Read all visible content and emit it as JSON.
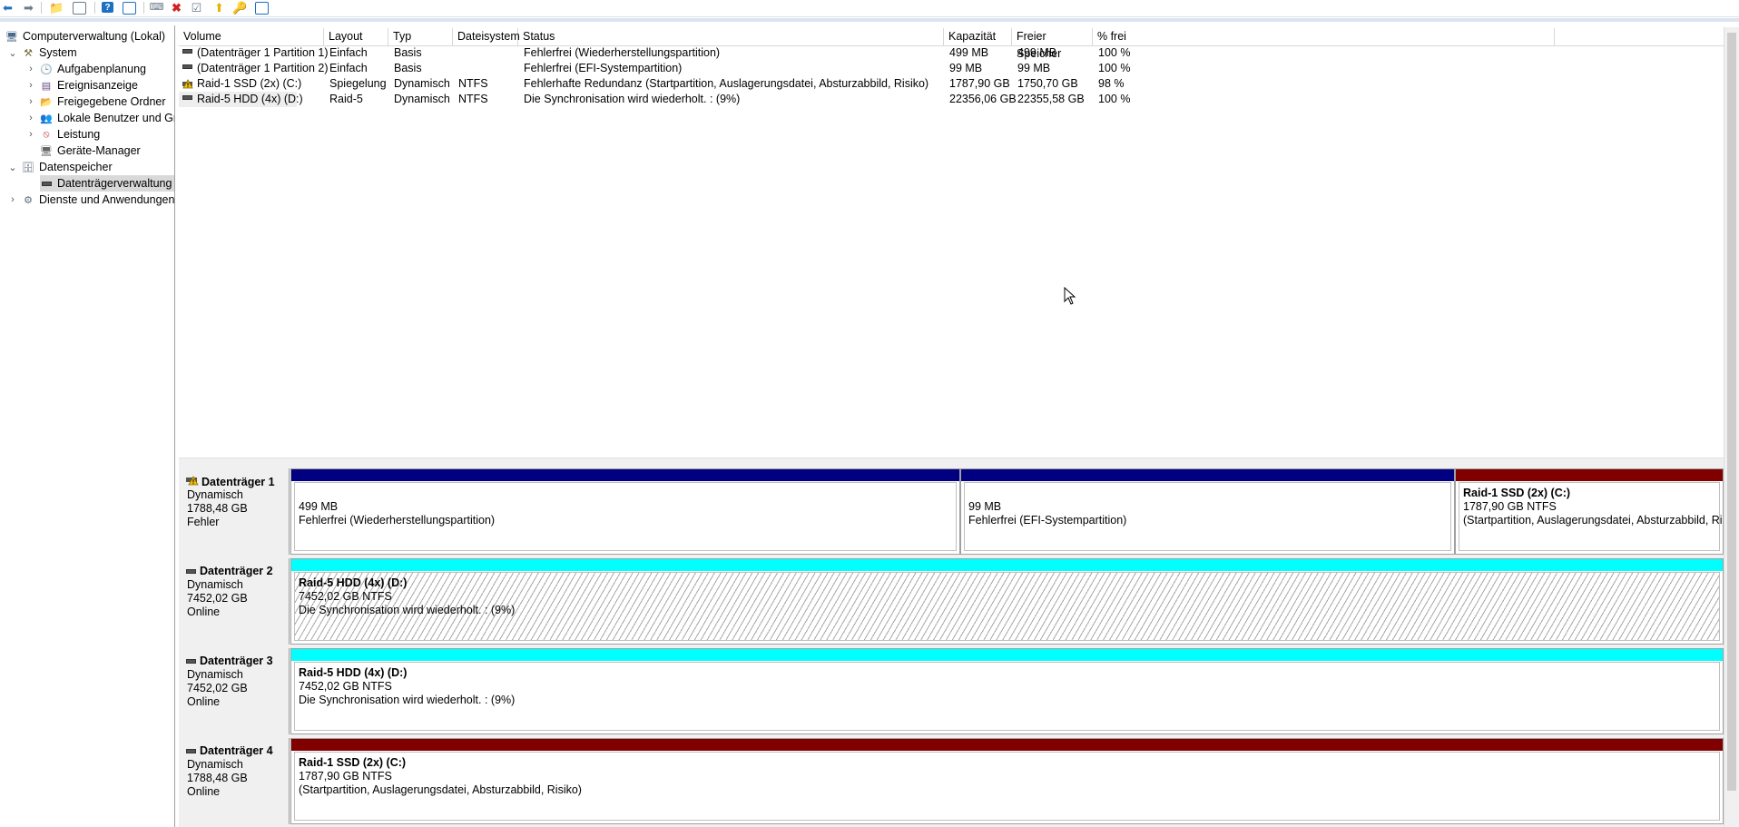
{
  "toolbar": {
    "buttons": [
      "back-icon",
      "forward-icon",
      "up-folder-icon",
      "console-tree-icon",
      "help-icon",
      "properties-icon",
      "connect-icon",
      "delete-icon",
      "checkmark-icon",
      "export-icon",
      "disk-action-icon",
      "list-view-icon"
    ],
    "colors": {
      "blue": "#1e6fc2",
      "red": "#d42020",
      "yellow": "#e3b400",
      "gray": "#6b7b8c"
    }
  },
  "tree": {
    "root": "Computerverwaltung (Lokal)",
    "system": "System",
    "aufgabenplanung": "Aufgabenplanung",
    "ereignisanzeige": "Ereignisanzeige",
    "freigegebene": "Freigegebene Ordner",
    "benutzer": "Lokale Benutzer und Gr",
    "leistung": "Leistung",
    "geraete": "Geräte-Manager",
    "datenspeicher": "Datenspeicher",
    "datentraeger": "Datenträgerverwaltung",
    "dienste": "Dienste und Anwendungen"
  },
  "volumes": {
    "headers": {
      "volume": "Volume",
      "layout": "Layout",
      "typ": "Typ",
      "dateisystem": "Dateisystem",
      "status": "Status",
      "kapazitaet": "Kapazität",
      "frei": "Freier Speicher",
      "prozent": "% frei"
    },
    "rows": [
      {
        "volume": "(Datenträger 1 Partition 1)",
        "layout": "Einfach",
        "typ": "Basis",
        "dateisystem": "",
        "status": "Fehlerfrei (Wiederherstellungspartition)",
        "kapazitaet": "499 MB",
        "frei": "499 MB",
        "prozent": "100 %"
      },
      {
        "volume": "(Datenträger 1 Partition 2)",
        "layout": "Einfach",
        "typ": "Basis",
        "dateisystem": "",
        "status": "Fehlerfrei (EFI-Systempartition)",
        "kapazitaet": "99 MB",
        "frei": "99 MB",
        "prozent": "100 %"
      },
      {
        "volume": "Raid-1 SSD (2x) (C:)",
        "layout": "Spiegelung",
        "typ": "Dynamisch",
        "dateisystem": "NTFS",
        "status": "Fehlerhafte Redundanz (Startpartition, Auslagerungsdatei, Absturzabbild, Risiko)",
        "kapazitaet": "1787,90 GB",
        "frei": "1750,70 GB",
        "prozent": "98 %"
      },
      {
        "volume": "Raid-5 HDD (4x) (D:)",
        "layout": "Raid-5",
        "typ": "Dynamisch",
        "dateisystem": "NTFS",
        "status": "Die Synchronisation wird wiederholt. : (9%)",
        "kapazitaet": "22356,06 GB",
        "frei": "22355,58 GB",
        "prozent": "100 %"
      }
    ]
  },
  "disks": [
    {
      "name": "Datenträger 1",
      "type": "Dynamisch",
      "size": "1788,48 GB",
      "state": "Fehler",
      "partitions": [
        {
          "title": "",
          "line1": "499 MB",
          "line2": "Fehlerfrei (Wiederherstellungspartition)",
          "bar": "#000080"
        },
        {
          "title": "",
          "line1": "99 MB",
          "line2": "Fehlerfrei (EFI-Systempartition)",
          "bar": "#000080"
        },
        {
          "title": "Raid-1 SSD (2x)  (C:)",
          "line1": "1787,90 GB NTFS",
          "line2": " (Startpartition, Auslagerungsdatei, Absturzabbild, Risiko)",
          "bar": "#800000"
        }
      ]
    },
    {
      "name": "Datenträger 2",
      "type": "Dynamisch",
      "size": "7452,02 GB",
      "state": "Online",
      "partitions": [
        {
          "title": "Raid-5 HDD (4x)  (D:)",
          "line1": "7452,02 GB NTFS",
          "line2": "Die Synchronisation wird wiederholt. : (9%)",
          "bar": "#00ffff"
        }
      ]
    },
    {
      "name": "Datenträger 3",
      "type": "Dynamisch",
      "size": "7452,02 GB",
      "state": "Online",
      "partitions": [
        {
          "title": "Raid-5 HDD (4x)  (D:)",
          "line1": "7452,02 GB NTFS",
          "line2": "Die Synchronisation wird wiederholt. : (9%)",
          "bar": "#00ffff"
        }
      ]
    },
    {
      "name": "Datenträger 4",
      "type": "Dynamisch",
      "size": "1788,48 GB",
      "state": "Online",
      "partitions": [
        {
          "title": "Raid-1 SSD (2x)  (C:)",
          "line1": "1787,90 GB NTFS",
          "line2": " (Startpartition, Auslagerungsdatei, Absturzabbild, Risiko)",
          "bar": "#800000"
        }
      ]
    }
  ]
}
